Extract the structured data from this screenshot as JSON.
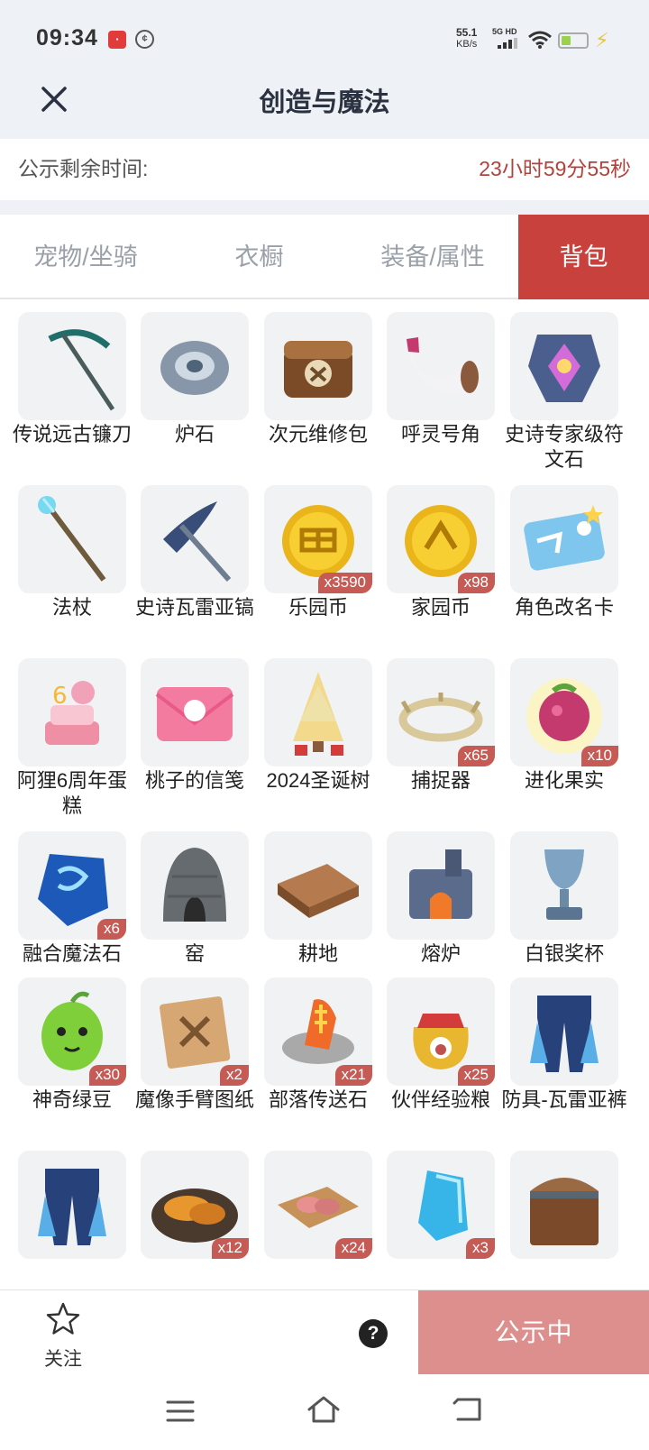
{
  "status_bar": {
    "time": "09:34",
    "net_speed": "55.1",
    "net_speed_unit": "KB/s",
    "network": "5G HD",
    "battery_level": 0.3
  },
  "header": {
    "title": "创造与魔法"
  },
  "countdown": {
    "label": "公示剩余时间:",
    "value": "23小时59分55秒"
  },
  "tabs": [
    {
      "label": "宠物/坐骑",
      "active": false
    },
    {
      "label": "衣橱",
      "active": false
    },
    {
      "label": "装备/属性",
      "active": false
    },
    {
      "label": "背包",
      "active": true
    }
  ],
  "items": [
    {
      "name": "传说远古镰刀",
      "qty": "",
      "icon": "scythe-icon"
    },
    {
      "name": "炉石",
      "qty": "",
      "icon": "hearthstone-icon"
    },
    {
      "name": "次元维修包",
      "qty": "",
      "icon": "repair-bag-icon"
    },
    {
      "name": "呼灵号角",
      "qty": "",
      "icon": "horn-icon"
    },
    {
      "name": "史诗专家级符文石",
      "qty": "",
      "icon": "rune-stone-icon"
    },
    {
      "name": "法杖",
      "qty": "",
      "icon": "staff-icon"
    },
    {
      "name": "史诗瓦雷亚镐",
      "qty": "",
      "icon": "pickaxe-icon"
    },
    {
      "name": "乐园币",
      "qty": "x3590",
      "icon": "paradise-coin-icon"
    },
    {
      "name": "家园币",
      "qty": "x98",
      "icon": "home-coin-icon"
    },
    {
      "name": "角色改名卡",
      "qty": "",
      "icon": "rename-card-icon"
    },
    {
      "name": "阿狸6周年蛋糕",
      "qty": "",
      "icon": "cake-icon"
    },
    {
      "name": "桃子的信笺",
      "qty": "",
      "icon": "letter-icon"
    },
    {
      "name": "2024圣诞树",
      "qty": "",
      "icon": "christmas-tree-icon"
    },
    {
      "name": "捕捉器",
      "qty": "x65",
      "icon": "catcher-icon"
    },
    {
      "name": "进化果实",
      "qty": "x10",
      "icon": "evolution-fruit-icon"
    },
    {
      "name": "融合魔法石",
      "qty": "x6",
      "icon": "magic-stone-icon"
    },
    {
      "name": "窑",
      "qty": "",
      "icon": "kiln-icon"
    },
    {
      "name": "耕地",
      "qty": "",
      "icon": "farmland-icon"
    },
    {
      "name": "熔炉",
      "qty": "",
      "icon": "furnace-icon"
    },
    {
      "name": "白银奖杯",
      "qty": "",
      "icon": "silver-trophy-icon"
    },
    {
      "name": "神奇绿豆",
      "qty": "x30",
      "icon": "green-bean-icon"
    },
    {
      "name": "魔像手臂图纸",
      "qty": "x2",
      "icon": "blueprint-icon"
    },
    {
      "name": "部落传送石",
      "qty": "x21",
      "icon": "teleport-stone-icon"
    },
    {
      "name": "伙伴经验粮",
      "qty": "x25",
      "icon": "exp-food-bag-icon"
    },
    {
      "name": "防具-瓦雷亚裤",
      "qty": "",
      "icon": "armor-pants-icon"
    },
    {
      "name": "",
      "qty": "",
      "icon": "armor-pants-icon"
    },
    {
      "name": "",
      "qty": "x12",
      "icon": "fried-food-icon"
    },
    {
      "name": "",
      "qty": "x24",
      "icon": "meat-tray-icon"
    },
    {
      "name": "",
      "qty": "x3",
      "icon": "ice-crystal-icon"
    },
    {
      "name": "",
      "qty": "",
      "icon": "chest-icon"
    }
  ],
  "bottom_bar": {
    "follow_label": "关注",
    "help_symbol": "?",
    "public_button": "公示中"
  },
  "colors": {
    "accent": "#c8413c",
    "button_disabled": "#dc8f8c",
    "countdown": "#b3423c",
    "background": "#eef1f5"
  }
}
